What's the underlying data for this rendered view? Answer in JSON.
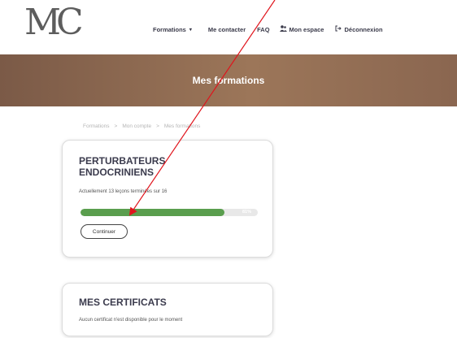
{
  "header": {
    "logo_text": "MC",
    "nav": [
      {
        "label": "Formations",
        "has_caret": true,
        "icon": ""
      },
      {
        "label": "Me contacter",
        "has_caret": false,
        "icon": ""
      },
      {
        "label": "FAQ",
        "has_caret": false,
        "icon": ""
      },
      {
        "label": "Mon espace",
        "has_caret": false,
        "icon": "user-icon"
      },
      {
        "label": "Déconnexion",
        "has_caret": false,
        "icon": "logout-icon"
      }
    ]
  },
  "banner": {
    "title": "Mes formations"
  },
  "breadcrumb": [
    "Formations",
    ">",
    "Mon compte",
    ">",
    "Mes formations"
  ],
  "course_card": {
    "title": "PERTURBATEURS ENDOCRINIENS",
    "status": "Actuellement 13 leçons terminées sur 16",
    "progress_percent": 81,
    "progress_label": "81%",
    "continue_label": "Continuer"
  },
  "certificates_card": {
    "title": "MES CERTIFICATS",
    "message": "Aucun certificat n'est disponible pour le moment"
  },
  "colors": {
    "banner": "#8a6650",
    "progress": "#5a9e4e",
    "annotation_arrow": "#e0141c"
  }
}
